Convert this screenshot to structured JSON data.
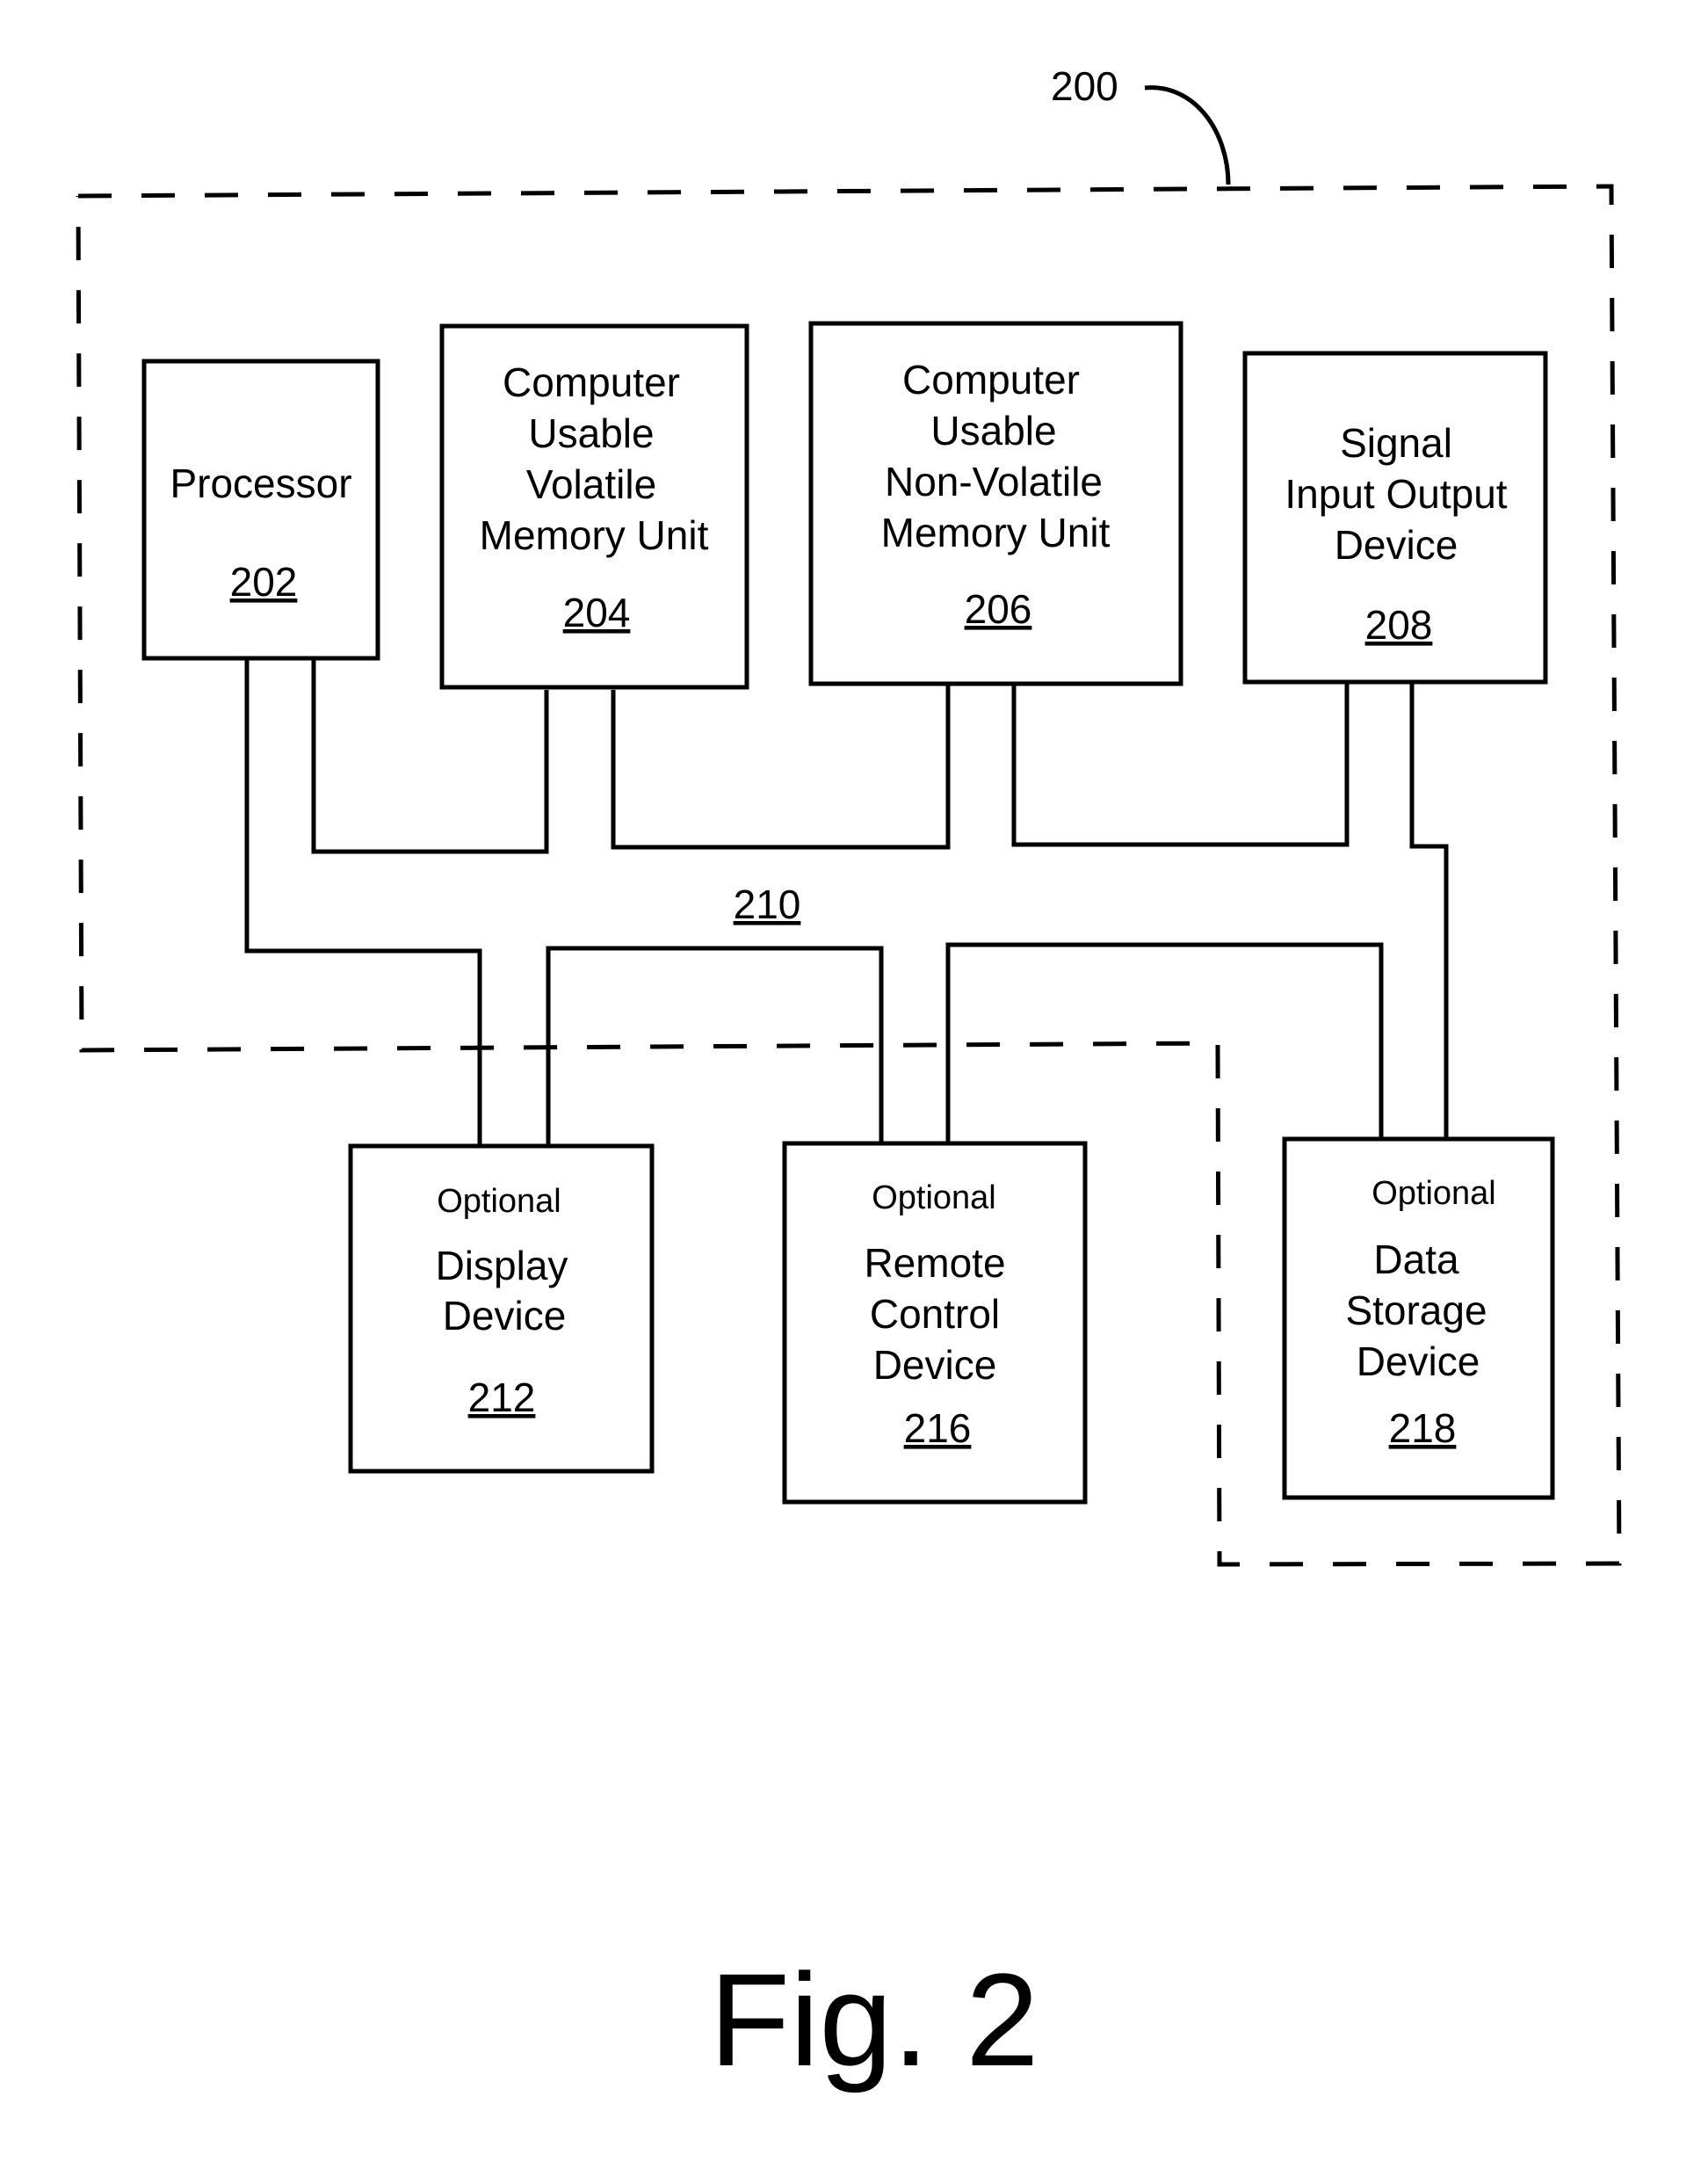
{
  "figure": {
    "caption": "Fig. 2",
    "system_ref": "200",
    "bus_ref": "210"
  },
  "blocks": [
    {
      "id": "processor",
      "ref": "202",
      "optional": false,
      "lines": [
        "Processor"
      ]
    },
    {
      "id": "volatile-memory",
      "ref": "204",
      "optional": false,
      "lines": [
        "Computer",
        "Usable",
        "Volatile",
        "Memory Unit"
      ]
    },
    {
      "id": "non-volatile-memory",
      "ref": "206",
      "optional": false,
      "lines": [
        "Computer",
        "Usable",
        "Non-Volatile",
        "Memory Unit"
      ]
    },
    {
      "id": "signal-io",
      "ref": "208",
      "optional": false,
      "lines": [
        "Signal",
        "Input Output",
        "Device"
      ]
    },
    {
      "id": "display-device",
      "ref": "212",
      "optional": true,
      "optional_label": "Optional",
      "lines": [
        "Display",
        "Device"
      ]
    },
    {
      "id": "remote-control-device",
      "ref": "216",
      "optional": true,
      "optional_label": "Optional",
      "lines": [
        "Remote",
        "Control",
        "Device"
      ]
    },
    {
      "id": "data-storage-device",
      "ref": "218",
      "optional": true,
      "optional_label": "Optional",
      "lines": [
        "Data",
        "Storage",
        "Device"
      ]
    }
  ]
}
